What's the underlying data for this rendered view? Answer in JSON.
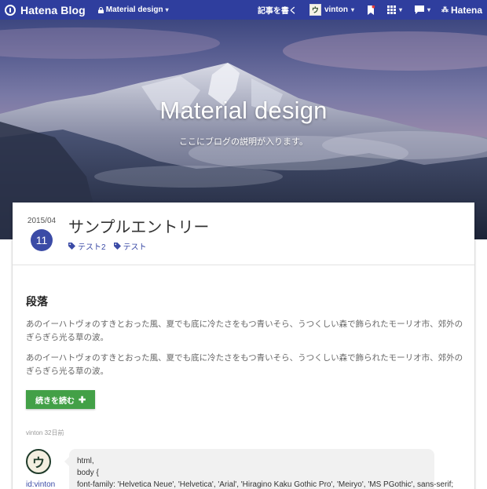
{
  "globalbar": {
    "brand": "Hatena Blog",
    "blog_selector": "Material design",
    "write_label": "記事を書く",
    "avatar_glyph": "ウ",
    "username": "vinton",
    "hatena_label": "Hatena",
    "bg_color": "#2f3e9e"
  },
  "hero": {
    "title": "Material design",
    "description": "ここにブログの説明が入ります。"
  },
  "entry": {
    "date_ym": "2015/04",
    "date_day": "11",
    "title": "サンプルエントリー",
    "tags": [
      "テスト2",
      "テスト"
    ],
    "section_heading": "段落",
    "paragraphs": [
      "あのイーハトヴォのすきとおった風、夏でも底に冷たさをもつ青いそら、うつくしい森で飾られたモーリオ市、郊外のぎらぎら光る草の波。",
      "あのイーハトヴォのすきとおった風、夏でも底に冷たさをもつ青いそら、うつくしい森で飾られたモーリオ市、郊外のぎらぎら光る草の波。"
    ],
    "more_label": "続きを読む",
    "author_meta": "vinton 32日前",
    "accent_color": "#3b4ba6",
    "button_color": "#43a047"
  },
  "comment": {
    "avatar_glyph": "ウ",
    "user": "id:vinton",
    "lines": [
      "html,",
      "body {",
      "font-family: 'Helvetica Neue', 'Helvetica', 'Arial', 'Hiragino Kaku Gothic Pro', 'Meiryo', 'MS PGothic', sans-serif;"
    ]
  }
}
